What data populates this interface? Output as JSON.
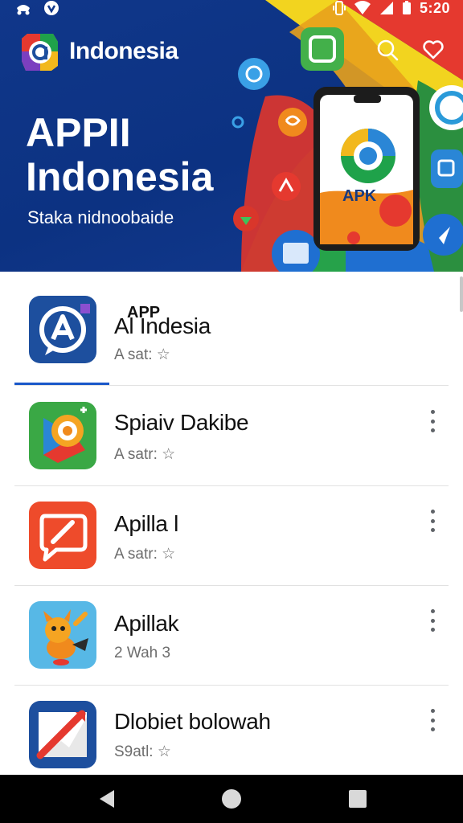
{
  "status_bar": {
    "time": "5:20",
    "icons": [
      "notification-icon",
      "shield-icon",
      "vibrate-icon",
      "wifi-icon",
      "signal-icon",
      "battery-icon"
    ]
  },
  "header": {
    "brand_name": "Indonesia",
    "search_icon": "search-icon",
    "favorite_icon": "heart-icon"
  },
  "hero": {
    "title_line1": "APPII",
    "title_line2": "Indonesia",
    "subtitle": "Staka nidnoobaide",
    "phone_label": "APK"
  },
  "apps": [
    {
      "name": "APP",
      "name_overlay": "Al Indesia",
      "meta": "A sat: ☆",
      "icon": "a-chat-icon",
      "icon_bg": "#1d4f9e"
    },
    {
      "name": "Spiaiv Dakibe",
      "meta": "A satr: ☆",
      "icon": "play-chat-icon",
      "icon_bg": "#3aa845"
    },
    {
      "name": "Apilla l",
      "meta": "A satr: ☆",
      "icon": "compose-icon",
      "icon_bg": "#ee4b2b"
    },
    {
      "name": "Apillak",
      "meta": "2 Wah 3",
      "icon": "fox-icon",
      "icon_bg": "#57b8e6"
    },
    {
      "name": "Dlobiet bolowah",
      "meta": "S9atl: ☆",
      "icon": "chart-icon",
      "icon_bg": "#1d4f9e"
    }
  ],
  "nav": {
    "back": "back-icon",
    "home": "home-icon",
    "recents": "recents-icon"
  },
  "colors": {
    "hero_blue": "#10378a",
    "accent_blue": "#1a57c9",
    "text_dark": "#111111",
    "text_meta": "#6d6d6d"
  }
}
